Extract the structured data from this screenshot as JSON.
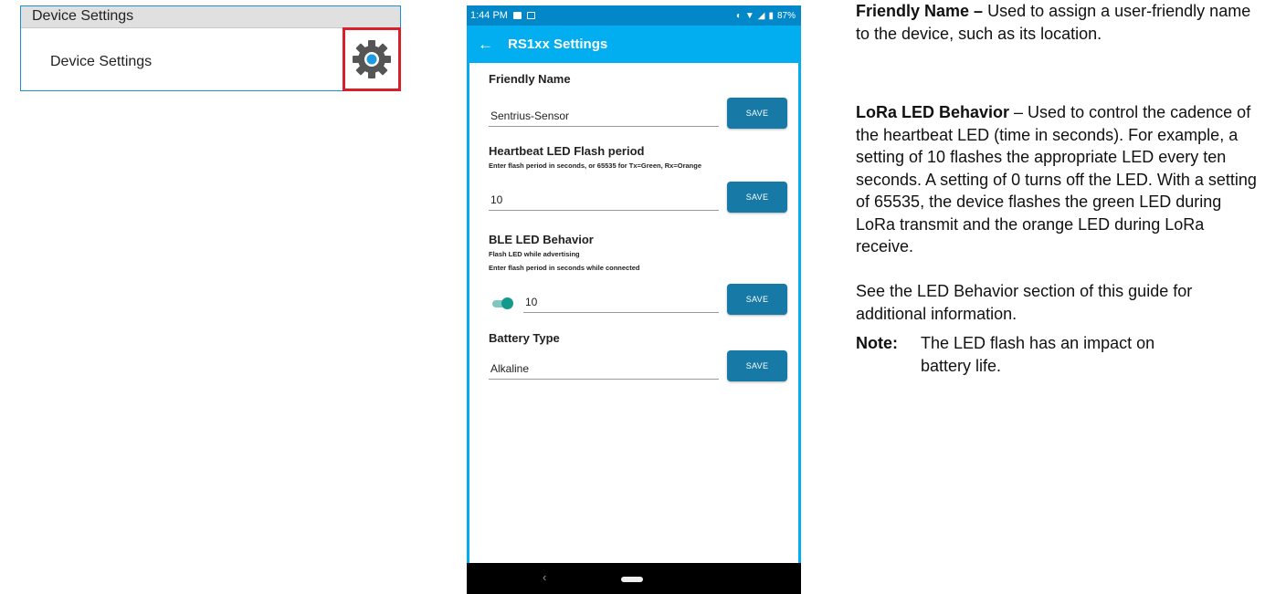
{
  "device_settings_panel": {
    "header": "Device Settings",
    "label": "Device Settings",
    "icon": "gear-icon",
    "highlight_color": "#d8202a"
  },
  "phone": {
    "status_bar": {
      "time": "1:44 PM",
      "battery": "87%"
    },
    "app_bar": {
      "title": "RS1xx Settings",
      "color": "#03aef0"
    },
    "sections": {
      "friendly_name": {
        "title": "Friendly Name",
        "value": "Sentrius-Sensor",
        "button": "SAVE"
      },
      "heartbeat": {
        "title": "Heartbeat LED Flash period",
        "subtitle": "Enter flash period in seconds, or 65535 for Tx=Green, Rx=Orange",
        "value": "10",
        "button": "SAVE"
      },
      "ble": {
        "title": "BLE LED Behavior",
        "subtitle1": "Flash LED while advertising",
        "subtitle2": "Enter flash period in seconds while connected",
        "value": "10",
        "toggle_on": true,
        "button": "SAVE"
      },
      "battery": {
        "title": "Battery Type",
        "value": "Alkaline",
        "button": "SAVE"
      }
    },
    "button_color": "#1679a6"
  },
  "doc": {
    "p1_bold": "Friendly Name –",
    "p1_text": " Used to assign a user-friendly name to the device, such as its location.",
    "p2_bold": "LoRa LED Behavior",
    "p2_text": " – Used to control the cadence of the heartbeat LED (time in seconds). For example, a setting of 10 flashes the appropriate LED every ten seconds. A setting of 0 turns off the LED. With a setting of 65535, the device flashes the green LED during LoRa transmit and the orange LED during LoRa receive.",
    "p3": "See the LED Behavior section of this guide for additional information.",
    "note_label": "Note:",
    "note_text": "The LED flash has an impact on battery life."
  }
}
